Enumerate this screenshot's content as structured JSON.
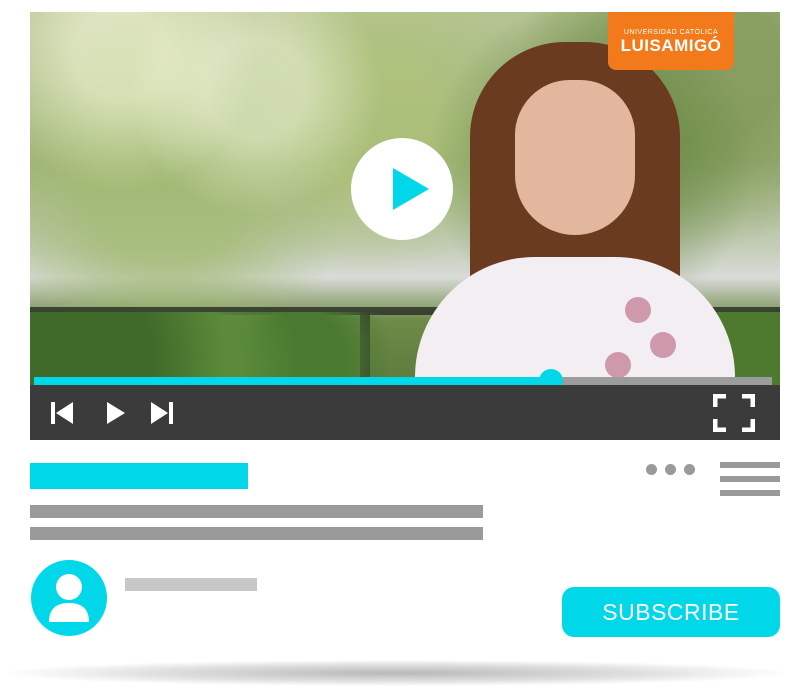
{
  "video": {
    "logo": {
      "line1": "UNIVERSIDAD CATÓLICA",
      "line2": "LUISAMIGÓ"
    },
    "progress": 0.7,
    "controls": {
      "play_icon": "play-icon",
      "previous_icon": "skip-previous-icon",
      "next_icon": "skip-next-icon",
      "fullscreen_icon": "fullscreen-icon"
    }
  },
  "actions": {
    "more_icon": "more-horizontal-icon",
    "menu_icon": "menu-icon"
  },
  "channel": {
    "avatar_icon": "user-avatar-icon",
    "subscribe_label": "SUBSCRIBE"
  },
  "colors": {
    "accent": "#00d8ea",
    "control_bar": "#3b3b3b",
    "placeholder_gray": "#9a9a9a",
    "logo_orange": "#f27a1a"
  }
}
